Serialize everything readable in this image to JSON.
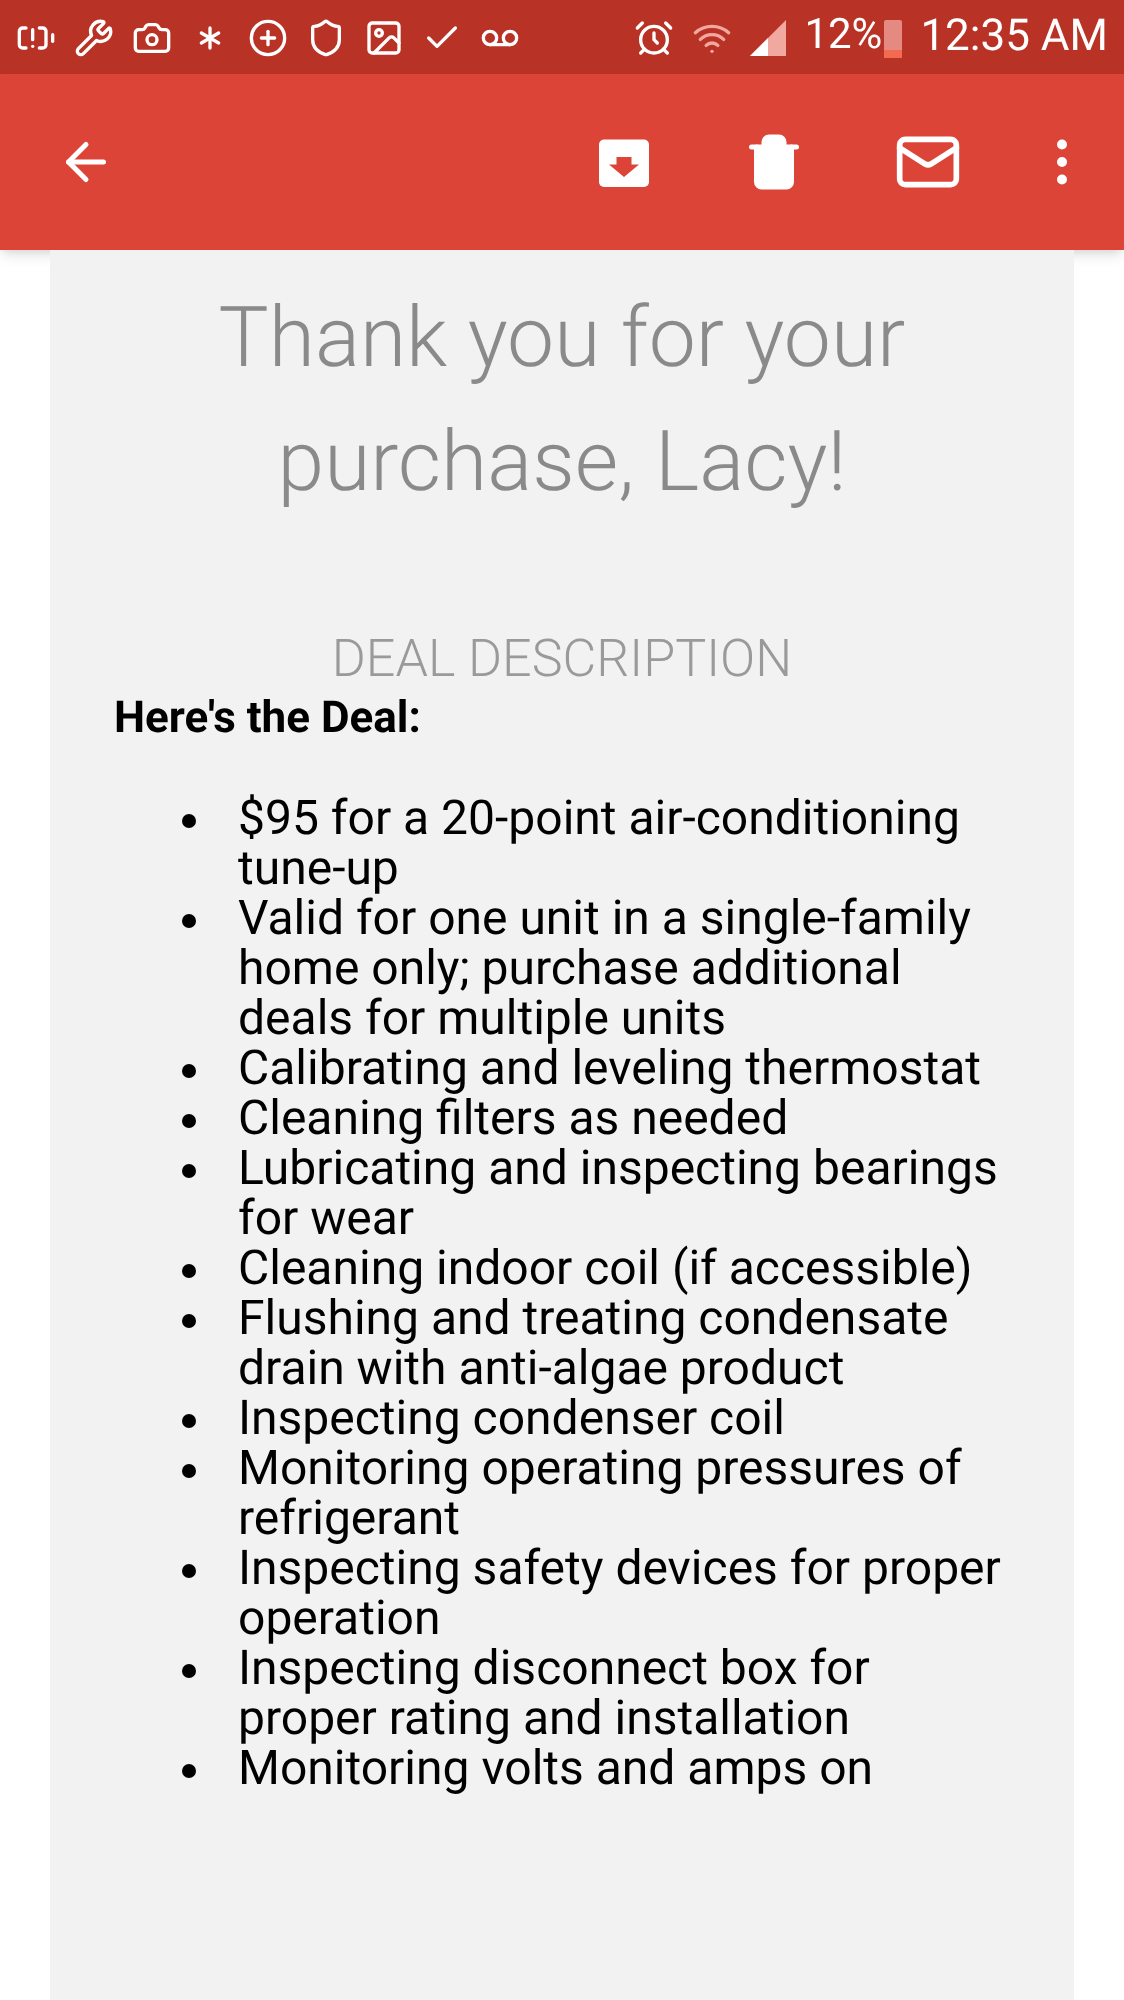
{
  "status_bar": {
    "battery": "12%",
    "time": "12:35 AM"
  },
  "email": {
    "title": "Thank you for your purchase, Lacy!",
    "section_heading": "DEAL DESCRIPTION",
    "deal_heading": "Here's the Deal:",
    "items": [
      "$95 for a 20-point air-conditioning tune-up",
      "Valid for one unit in a single-family home only; purchase additional deals for multiple units",
      "Calibrating and leveling thermostat",
      "Cleaning filters as needed",
      "Lubricating and inspecting bearings for wear",
      "Cleaning indoor coil (if accessible)",
      "Flushing and treating condensate drain with anti-algae product",
      "Inspecting condenser coil",
      "Monitoring operating pressures of refrigerant",
      "Inspecting safety devices for proper operation",
      "Inspecting disconnect box for proper rating and installation",
      "Monitoring volts and amps on"
    ]
  }
}
